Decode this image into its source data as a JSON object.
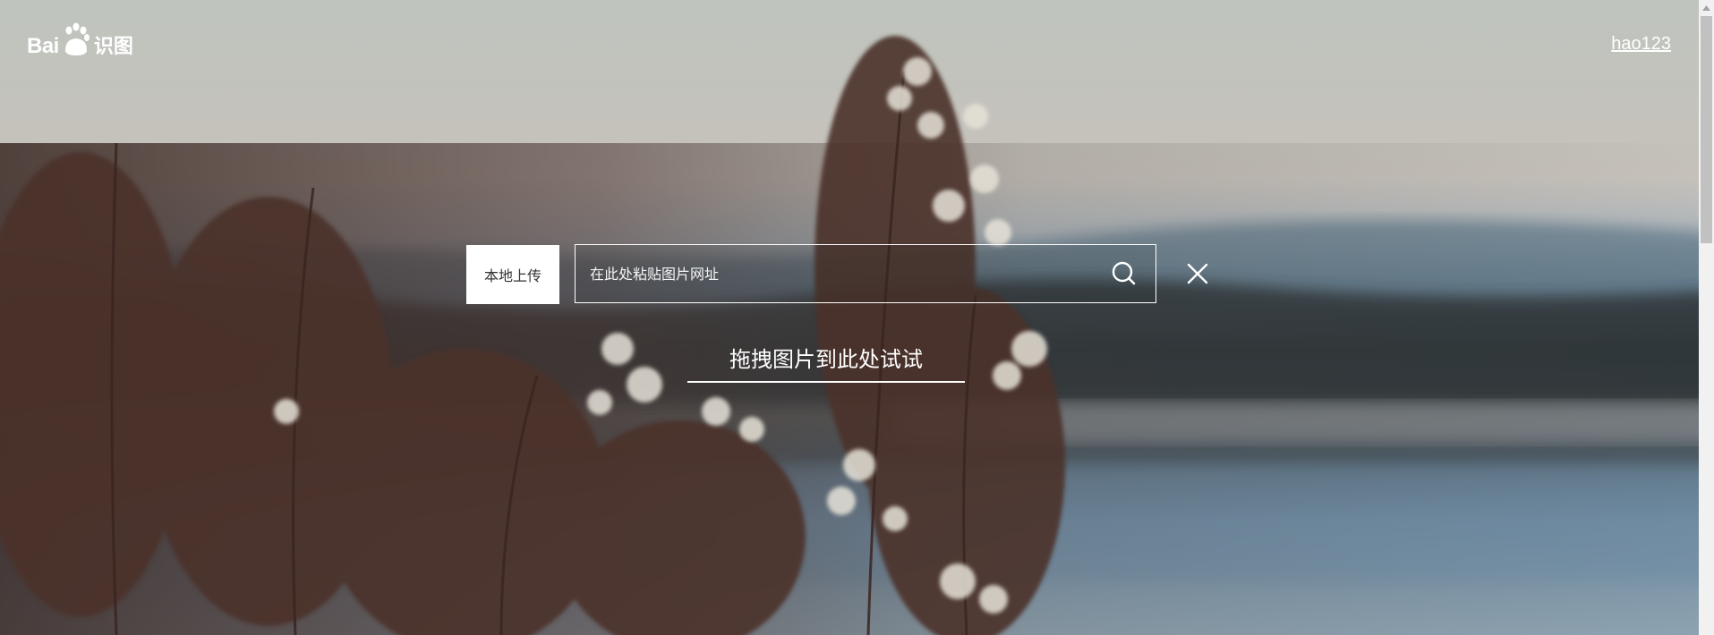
{
  "header": {
    "logo": {
      "brand": "Bai",
      "du": "du",
      "product": "识图",
      "icon": "paw-icon"
    },
    "link": "hao123"
  },
  "search": {
    "upload_label": "本地上传",
    "placeholder": "在此处粘贴图片网址",
    "value": "",
    "search_icon": "search-icon",
    "close_icon": "close-icon"
  },
  "drag_hint": "拖拽图片到此处试试",
  "colors": {
    "text": "#ffffff",
    "button_bg": "#ffffff",
    "scrollbar_track": "#f1f1f1",
    "scrollbar_thumb": "#c1c1c1"
  }
}
